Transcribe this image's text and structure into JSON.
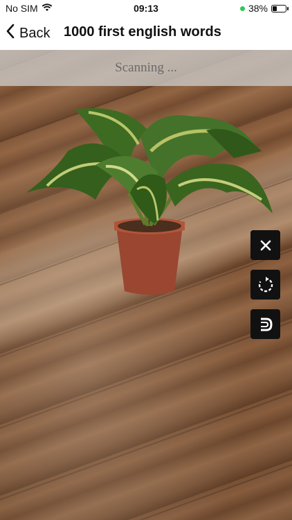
{
  "status_bar": {
    "carrier": "No SIM",
    "time": "09:13",
    "battery": "38%",
    "battery_level": 0.38,
    "icons": {
      "wifi": "wifi-icon",
      "battery": "battery-icon",
      "indicator": "green-dot-icon"
    }
  },
  "nav": {
    "back_label": "Back",
    "title": "1000 first english words",
    "back_icon": "chevron-left-icon"
  },
  "scan": {
    "status_text": "Scanning ..."
  },
  "scene": {
    "object_name": "potted-plant-model"
  },
  "controls": {
    "close_icon": "close-icon",
    "rotate_icon": "rotate-icon",
    "magnet_icon": "magnet-icon"
  },
  "colors": {
    "bar_bg": "#ffffff",
    "control_bg": "#111111",
    "control_fg": "#ffffff",
    "status_green": "#34c759",
    "banner_text": "#6a6a6a"
  }
}
